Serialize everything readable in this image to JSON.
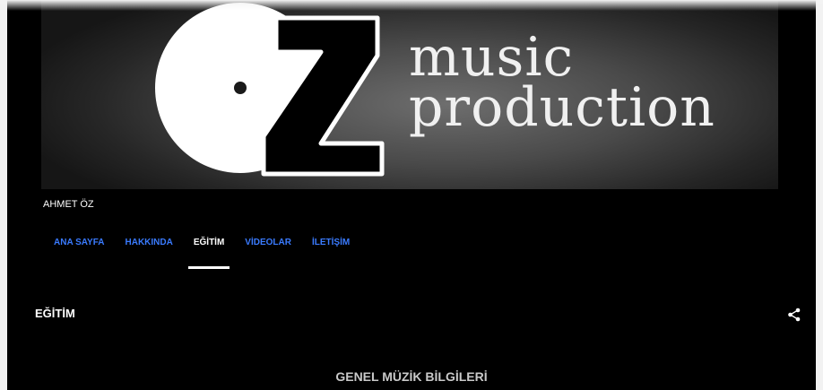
{
  "banner": {
    "logo_letters": "OZ",
    "text_line1": "music",
    "text_line2": "production"
  },
  "channel": {
    "name": "AHMET ÖZ"
  },
  "tabs": [
    {
      "label": "ANA SAYFA",
      "active": false
    },
    {
      "label": "HAKKINDA",
      "active": false
    },
    {
      "label": "EĞİTİM",
      "active": true
    },
    {
      "label": "VİDEOLAR",
      "active": false
    },
    {
      "label": "İLETİŞİM",
      "active": false
    }
  ],
  "section": {
    "title": "EĞİTİM",
    "share_icon": "share-icon"
  },
  "playlist": {
    "title": "GENEL MÜZİK BİLGİLERİ"
  },
  "colors": {
    "background": "#000000",
    "tab_link": "#3a7bff",
    "tab_active": "#ffffff"
  }
}
